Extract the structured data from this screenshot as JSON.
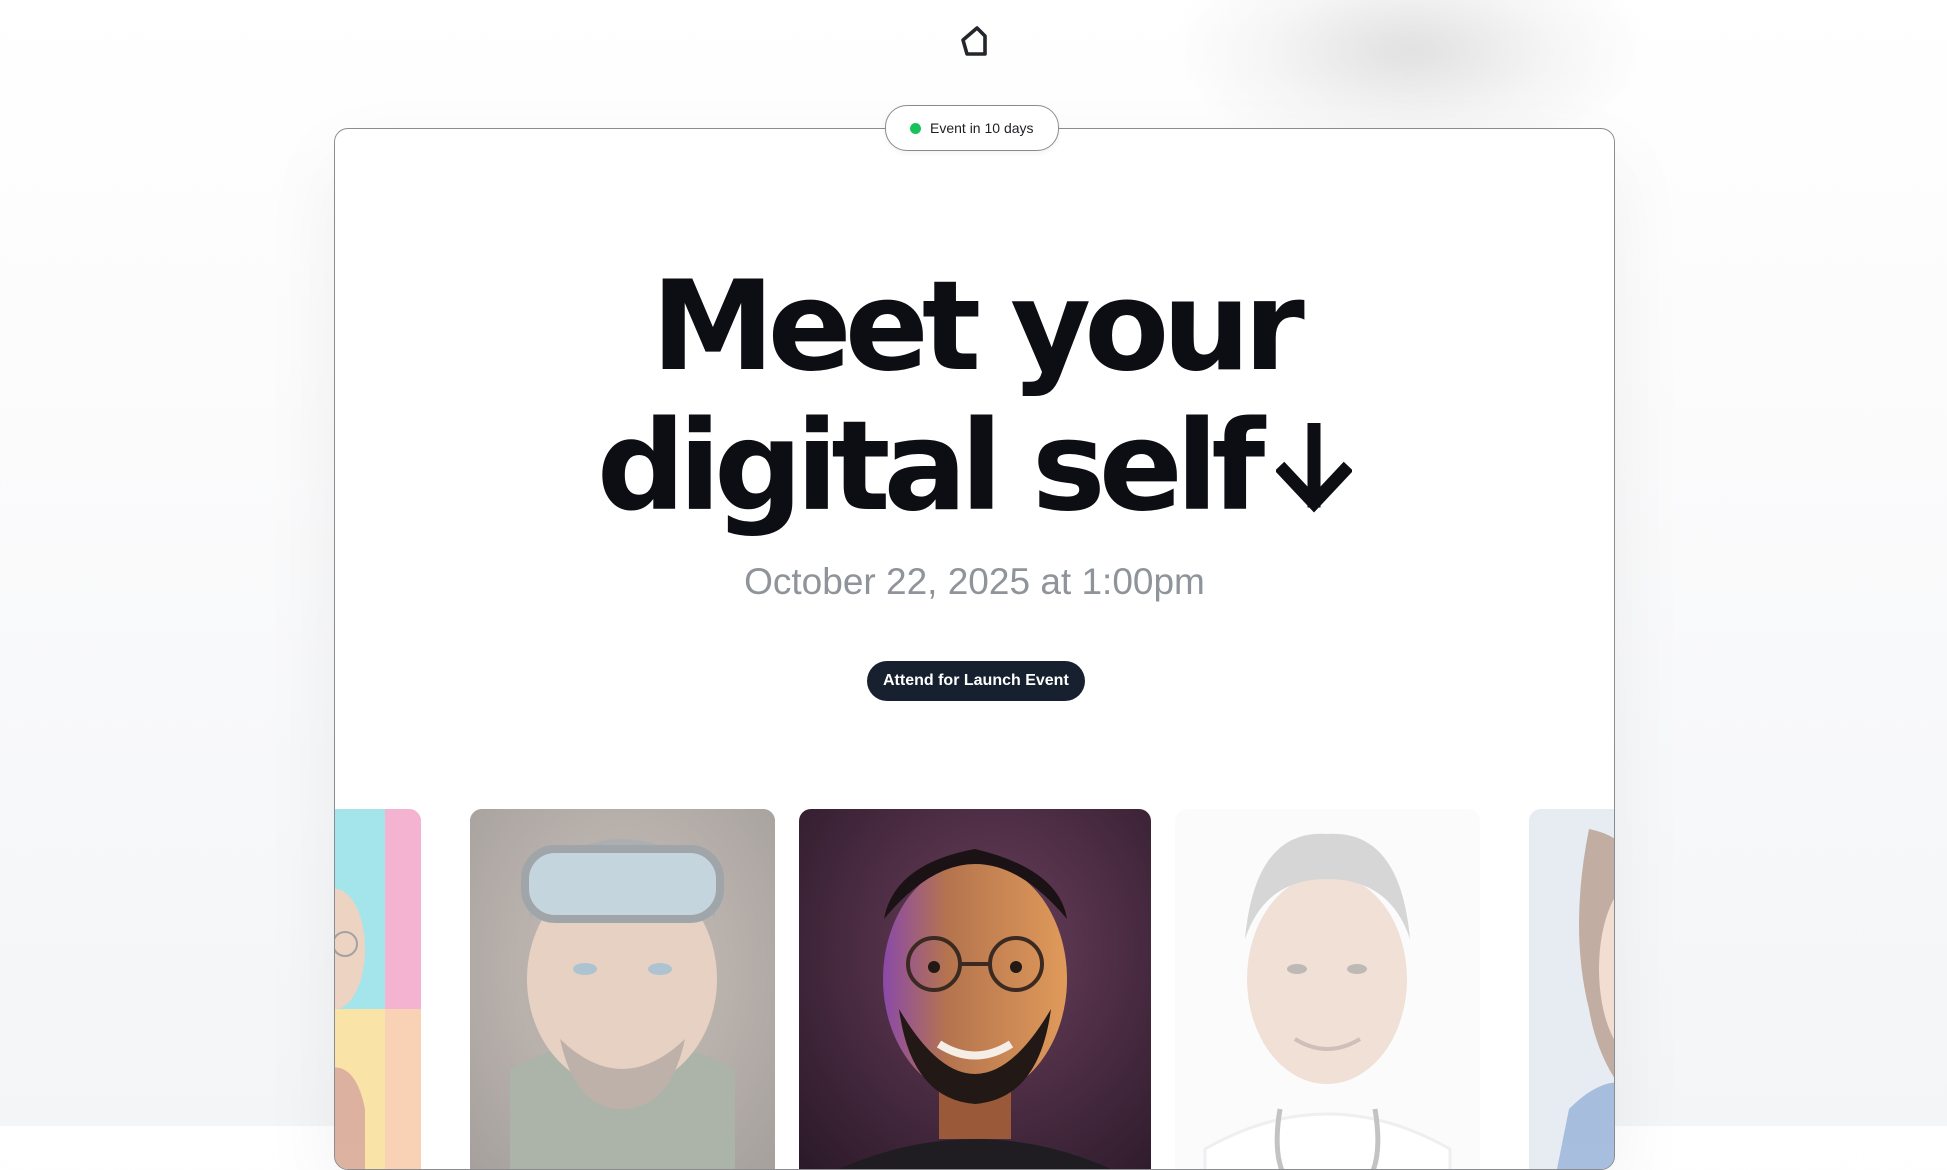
{
  "event": {
    "badge_label": "Event in 10 days",
    "status_color": "#18c25a"
  },
  "hero": {
    "title_line1": "Meet your",
    "title_line2": "digital self",
    "arrow_icon": "arrow-down-icon"
  },
  "schedule": {
    "date_text": "October 22, 2025 at 1:00pm"
  },
  "cta": {
    "label": "Attend for Launch Event",
    "color": "#16202e"
  },
  "gallery": {
    "portraits": [
      {
        "name": "portrait-colorful-partial",
        "active": false
      },
      {
        "name": "portrait-skier-goggles",
        "active": false
      },
      {
        "name": "portrait-man-glasses-smiling",
        "active": true
      },
      {
        "name": "portrait-doctor-gray-hair",
        "active": false
      },
      {
        "name": "portrait-woman-partial",
        "active": false
      }
    ]
  },
  "logo": {
    "icon": "brand-logo-icon"
  }
}
